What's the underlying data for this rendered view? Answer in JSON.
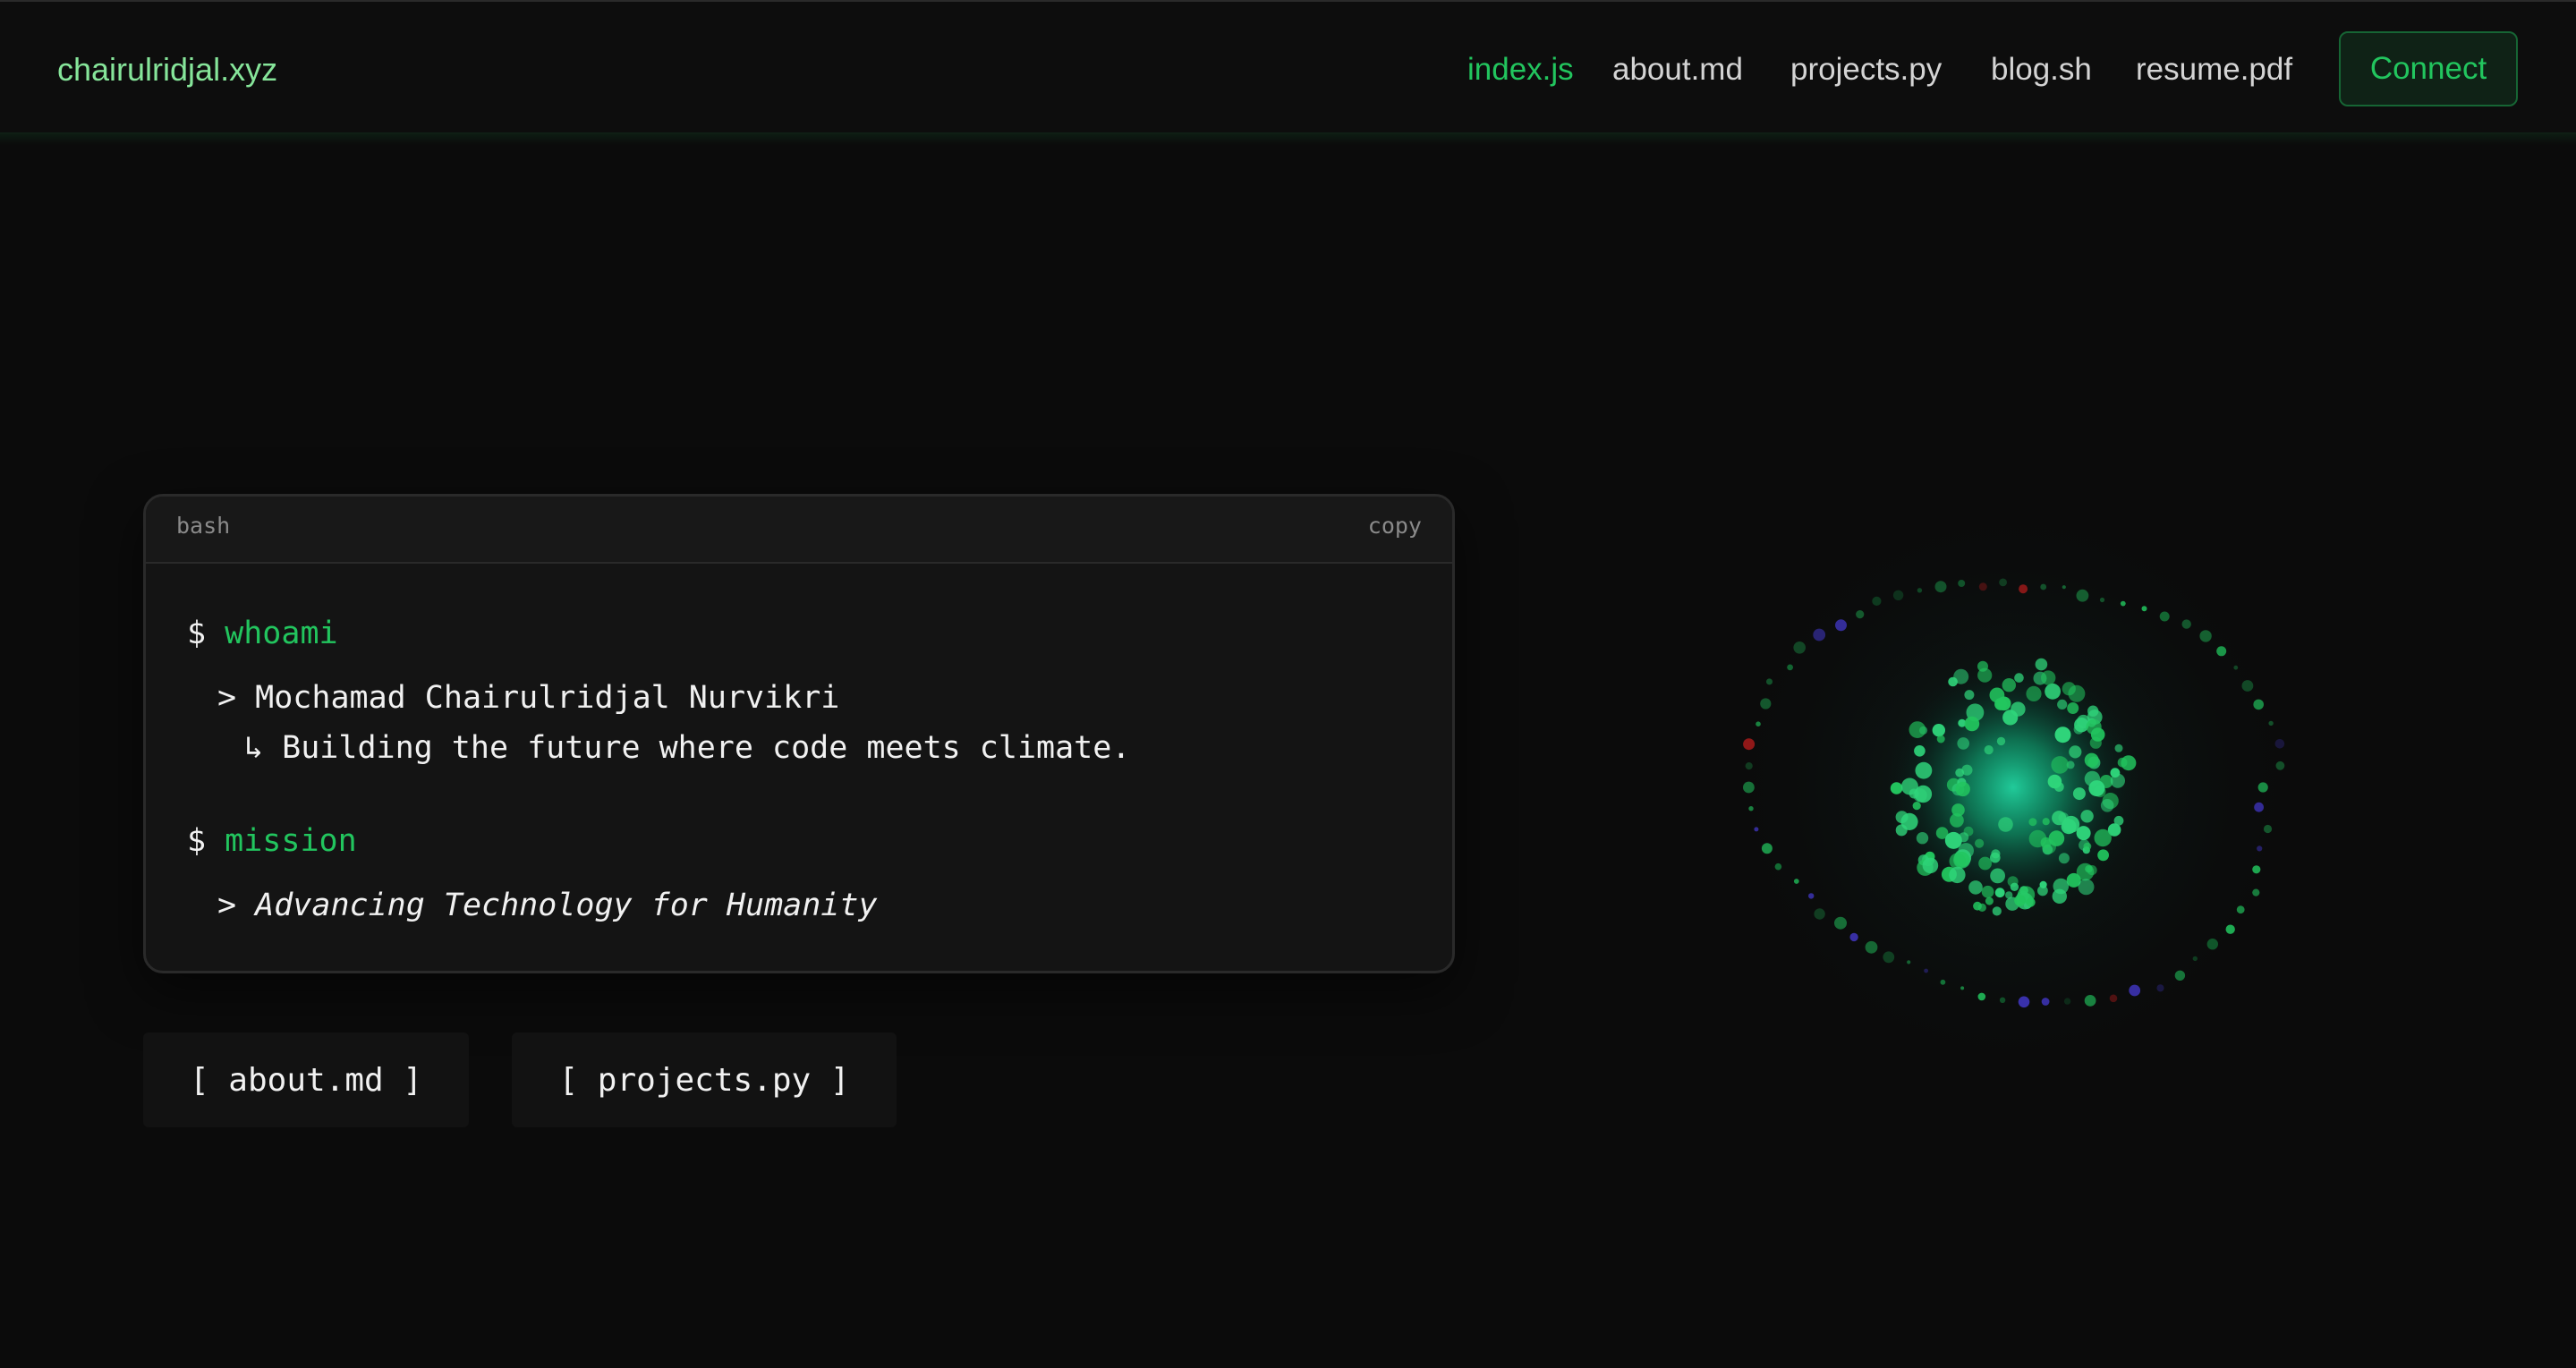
{
  "site": {
    "brand": "chairulridjal.xyz"
  },
  "nav": {
    "items": [
      {
        "label": "index.js",
        "active": true
      },
      {
        "label": "about.md",
        "active": false
      },
      {
        "label": "projects.py",
        "active": false
      },
      {
        "label": "blog.sh",
        "active": false
      },
      {
        "label": "resume.pdf",
        "active": false
      }
    ],
    "connect_label": "Connect"
  },
  "terminal": {
    "language": "bash",
    "copy_label": "copy",
    "prompt_symbol": "$",
    "commands": [
      {
        "command": "whoami",
        "output_marker": ">",
        "output": "Mochamad Chairulridjal Nurvikri",
        "sub_marker": "↳",
        "sub_output": "Building the future where code meets climate."
      },
      {
        "command": "mission",
        "output_marker": ">",
        "output": "Advancing Technology for Humanity"
      }
    ]
  },
  "links": [
    {
      "label": "[ about.md ]"
    },
    {
      "label": "[ projects.py ]"
    }
  ],
  "colors": {
    "background": "#0b0b0b",
    "accent": "#22c55e",
    "brand": "#86e59a",
    "text": "#f1f1f1",
    "muted": "#8a8a8a",
    "border": "#2a2a2a"
  }
}
